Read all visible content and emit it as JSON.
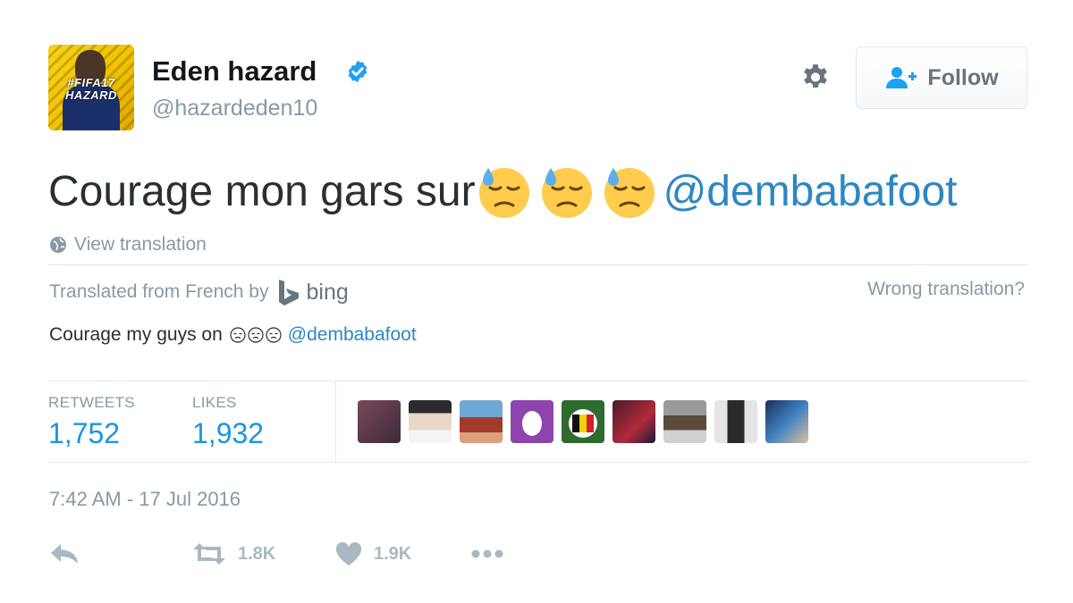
{
  "author": {
    "name": "Eden hazard",
    "handle": "@hazardeden10",
    "avatar_text": "#FIFA17 HAZARD",
    "verified": true,
    "avatar_color": "#f2c200"
  },
  "header": {
    "settings_icon": "gear-icon",
    "follow_label": "Follow",
    "follow_icon": "add-user-icon"
  },
  "tweet": {
    "text": "Courage mon gars sur",
    "emoji": [
      "downcast-face-with-sweat",
      "downcast-face-with-sweat",
      "downcast-face-with-sweat"
    ],
    "mention": "@dembabafoot",
    "link_color": "#1b95e0"
  },
  "translation": {
    "view_label": "View translation",
    "translated_from": "Translated from French by",
    "provider": "bing",
    "wrong_label": "Wrong translation?",
    "text": "Courage my guys on",
    "emoji_count": 3,
    "mention": "@dembabafoot"
  },
  "stats": {
    "retweets_label": "RETWEETS",
    "retweets_value": "1,752",
    "likes_label": "LIKES",
    "likes_value": "1,932",
    "liker_avatar_count": 9
  },
  "timestamp": "7:42 AM - 17 Jul 2016",
  "actions": {
    "reply_icon": "reply-icon",
    "retweet_icon": "retweet-icon",
    "retweet_count": "1.8K",
    "like_icon": "heart-icon",
    "like_count": "1.9K",
    "more_icon": "more-icon"
  }
}
